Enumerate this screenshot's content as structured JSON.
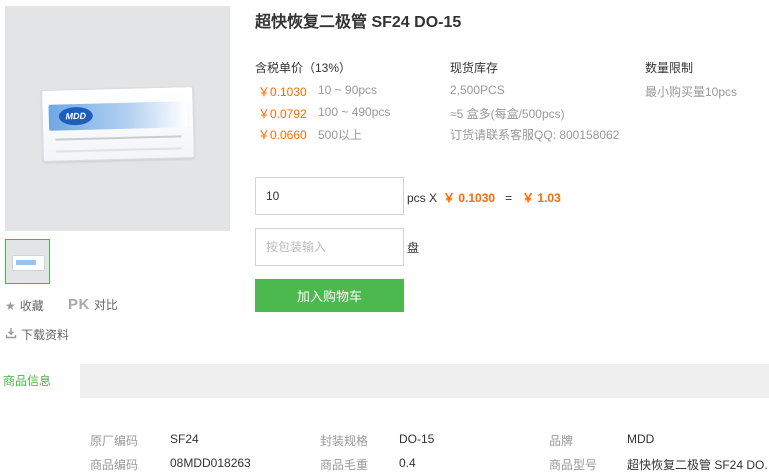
{
  "product": {
    "title": "超快恢复二极管 SF24 DO-15",
    "image_logo_text": "MDD"
  },
  "actions": {
    "favorite_label": "收藏",
    "compare_prefix": "PK",
    "compare_label": "对比",
    "download_label": "下载资料"
  },
  "pricing": {
    "header": "含税单价（13%）",
    "tiers": [
      {
        "price": "￥0.1030",
        "qty": "10 ~ 90pcs"
      },
      {
        "price": "￥0.0792",
        "qty": "100 ~ 490pcs"
      },
      {
        "price": "￥0.0660",
        "qty": "500以上"
      }
    ]
  },
  "stock": {
    "header": "现货库存",
    "quantity": "2,500PCS",
    "boxes": "≈5 盒多(每盒/500pcs)",
    "contact": "订货请联系客服QQ: 800158062"
  },
  "limit": {
    "header": "数量限制",
    "min": "最小购买量10pcs"
  },
  "order": {
    "qty_value": "10",
    "qty_unit": "pcs X",
    "unit_price": "￥ 0.1030",
    "equals": "=",
    "total": "￥ 1.03",
    "reel_placeholder": "按包装输入",
    "reel_unit": "盘",
    "add_to_cart": "加入购物车"
  },
  "tabs": {
    "active": "商品信息"
  },
  "specs": [
    [
      {
        "label": "原厂编码",
        "value": "SF24"
      },
      {
        "label": "封装规格",
        "value": "DO-15"
      },
      {
        "label": "品牌",
        "value": "MDD"
      }
    ],
    [
      {
        "label": "商品编码",
        "value": "08MDD018263"
      },
      {
        "label": "商品毛重",
        "value": "0.4"
      },
      {
        "label": "商品型号",
        "value": "超快恢复二极管 SF24 DO."
      }
    ]
  ],
  "colors": {
    "accent_green": "#4bb94e",
    "price_orange": "#ff6a00",
    "muted_text": "#999999"
  }
}
